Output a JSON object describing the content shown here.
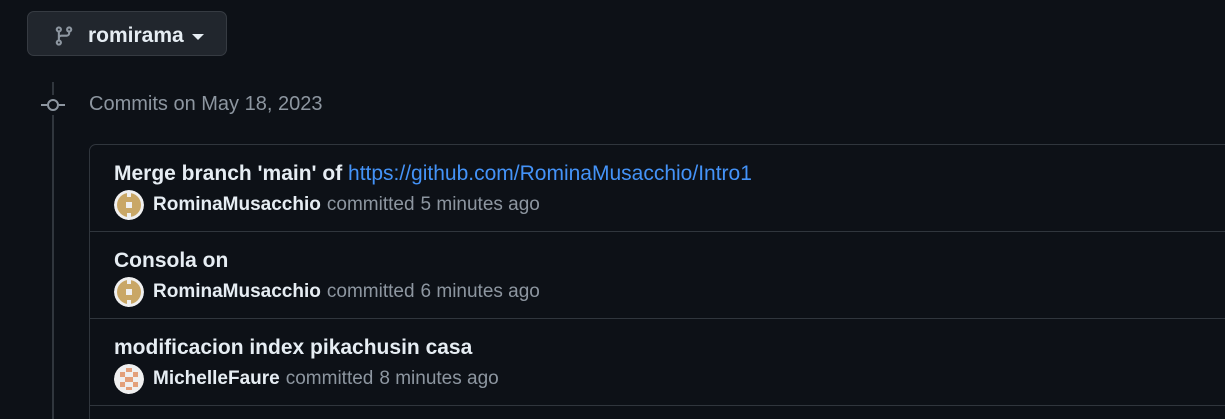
{
  "branch": {
    "name": "romirama",
    "icon": "git-branch-icon"
  },
  "timeline": {
    "heading": "Commits on May 18, 2023",
    "icon": "git-commit-icon"
  },
  "commits": [
    {
      "message": "Merge branch 'main' of ",
      "message_link": "https://github.com/RominaMusacchio/Intro1",
      "author": "RominaMusacchio",
      "action": "committed",
      "time": "5 minutes ago",
      "avatar_icon": "identicon-avatar"
    },
    {
      "message": "Consola on",
      "author": "RominaMusacchio",
      "action": "committed",
      "time": "6 minutes ago",
      "avatar_icon": "identicon-avatar"
    },
    {
      "message": "modificacion index pikachusin casa",
      "author": "MichelleFaure",
      "action": "committed",
      "time": "8 minutes ago",
      "avatar_icon": "identicon-avatar"
    }
  ],
  "colors": {
    "background": "#0d1117",
    "link": "#4493f8",
    "muted_text": "#8d96a0",
    "border": "#30363d",
    "button_bg": "#21262d",
    "avatar_romina": "#c9a766",
    "avatar_michelle": "#e3a07a"
  }
}
